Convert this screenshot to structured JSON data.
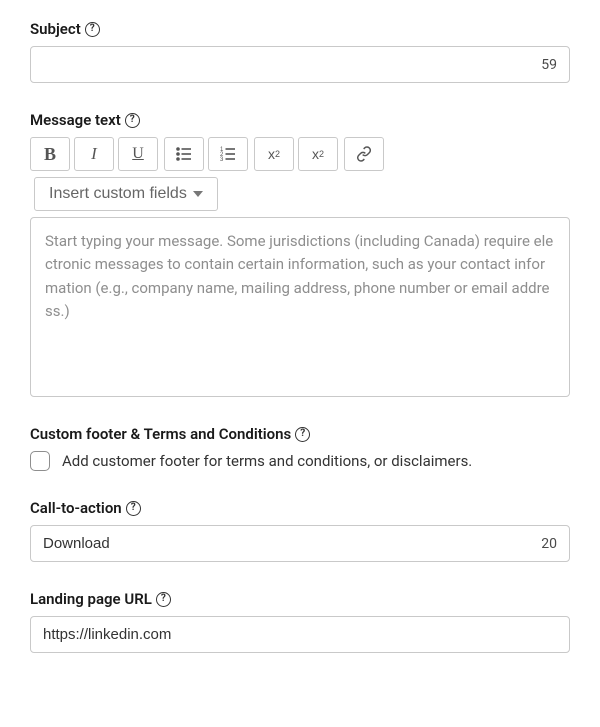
{
  "subject": {
    "label": "Subject",
    "value": "",
    "counter": "59"
  },
  "message": {
    "label": "Message text",
    "placeholder": "Start typing your message. Some jurisdictions (including Canada) require electronic messages to contain certain information, such as your contact information (e.g., company name, mailing address, phone number or email address.)",
    "custom_fields_label": "Insert custom fields"
  },
  "footer": {
    "label": "Custom footer & Terms and Conditions",
    "checkbox_label": "Add customer footer for terms and conditions, or disclaimers."
  },
  "cta": {
    "label": "Call-to-action",
    "value": "Download",
    "counter": "20"
  },
  "landing": {
    "label": "Landing page URL",
    "value": "https://linkedin.com"
  }
}
